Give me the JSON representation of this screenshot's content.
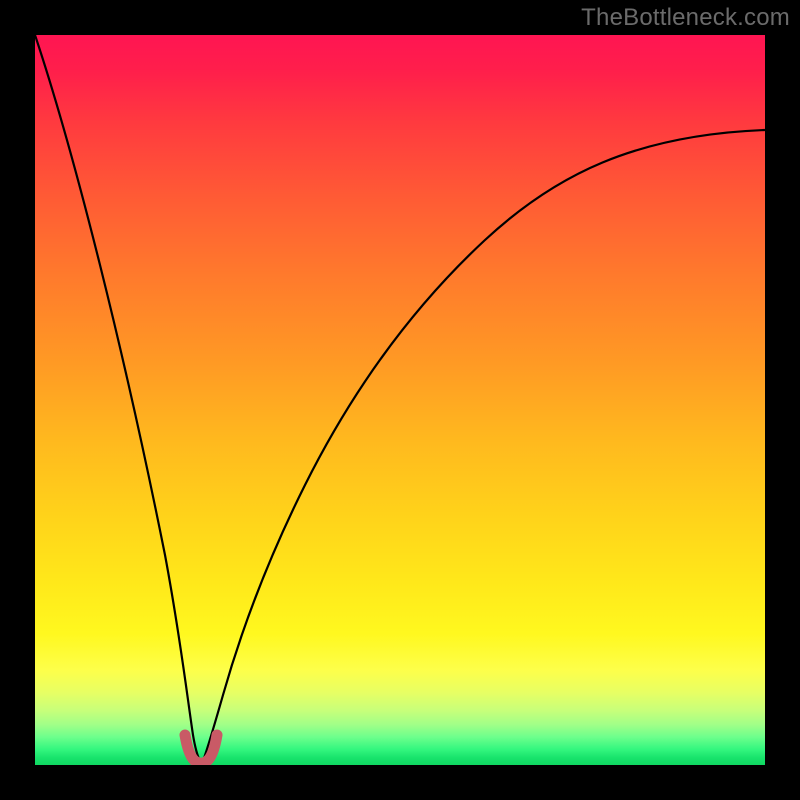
{
  "watermark": "TheBottleneck.com",
  "colors": {
    "background": "#000000",
    "curve": "#000000",
    "marker": "#c95a66",
    "watermark_text": "#6b6b6b"
  },
  "chart_data": {
    "type": "line",
    "title": "",
    "xlabel": "",
    "ylabel": "",
    "xlim": [
      0,
      100
    ],
    "ylim": [
      0,
      100
    ],
    "grid": false,
    "legend": false,
    "series": [
      {
        "name": "bottleneck-curve",
        "x": [
          0,
          5,
          10,
          15,
          18,
          20,
          21.5,
          23,
          25,
          27,
          30,
          33,
          37,
          42,
          48,
          55,
          62,
          70,
          78,
          86,
          94,
          100
        ],
        "y": [
          100,
          80,
          58,
          32,
          14,
          4,
          0.5,
          0.5,
          4,
          11,
          22,
          32,
          42,
          52,
          60,
          67,
          72,
          77,
          80.5,
          83,
          85,
          86.5
        ]
      }
    ],
    "annotations": [
      {
        "name": "minimum-marker",
        "shape": "u-shape",
        "x_range": [
          20.5,
          24.0
        ],
        "y_range": [
          0,
          4
        ],
        "color": "#c95a66"
      }
    ]
  }
}
